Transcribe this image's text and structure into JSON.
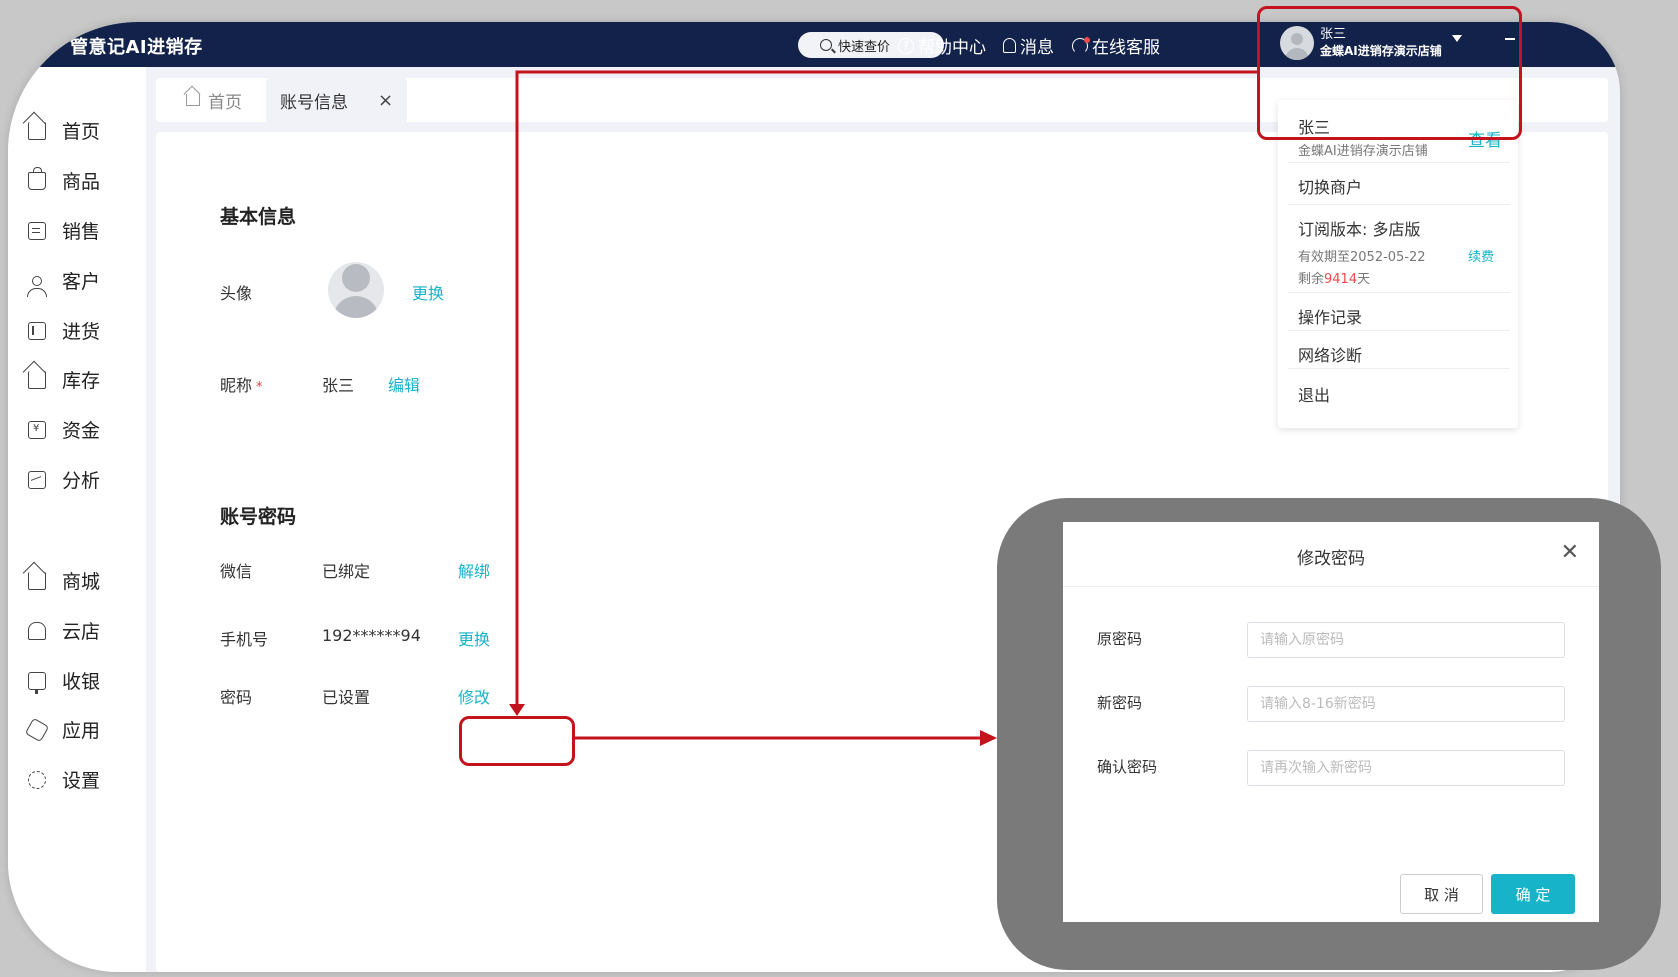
{
  "app": {
    "brand": "管意记AI进销存",
    "search_label": "快速查价",
    "topnav": {
      "help": "帮助中心",
      "messages": "消息",
      "service": "在线客服"
    },
    "user": {
      "name": "张三",
      "store": "金蝶AI进销存演示店铺"
    }
  },
  "sidebar": {
    "items": [
      {
        "label": "首页",
        "icon": "home-icon"
      },
      {
        "label": "商品",
        "icon": "bag-icon"
      },
      {
        "label": "销售",
        "icon": "document-icon"
      },
      {
        "label": "客户",
        "icon": "person-icon"
      },
      {
        "label": "进货",
        "icon": "book-icon"
      },
      {
        "label": "库存",
        "icon": "warehouse-icon"
      },
      {
        "label": "资金",
        "icon": "wallet-icon"
      },
      {
        "label": "分析",
        "icon": "chart-icon"
      },
      {
        "label": "商城",
        "icon": "mall-icon"
      },
      {
        "label": "云店",
        "icon": "shop-icon"
      },
      {
        "label": "收银",
        "icon": "cashier-icon"
      },
      {
        "label": "应用",
        "icon": "app-icon"
      },
      {
        "label": "设置",
        "icon": "gear-icon"
      }
    ]
  },
  "tabs": {
    "home": "首页",
    "account": "账号信息"
  },
  "basic": {
    "title": "基本信息",
    "avatar_label": "头像",
    "avatar_action": "更换",
    "nickname_label": "昵称",
    "nickname_required": "*",
    "nickname_value": "张三",
    "nickname_action": "编辑"
  },
  "account": {
    "title": "账号密码",
    "wechat_label": "微信",
    "wechat_value": "已绑定",
    "wechat_action": "解绑",
    "phone_label": "手机号",
    "phone_value": "192******94",
    "phone_action": "更换",
    "password_label": "密码",
    "password_value": "已设置",
    "password_action": "修改"
  },
  "dropdown": {
    "name": "张三",
    "store": "金蝶AI进销存演示店铺",
    "view": "查看",
    "switch": "切换商户",
    "plan": "订阅版本: 多店版",
    "expiry": "有效期至2052-05-22",
    "renew": "续费",
    "remaining_prefix": "剩余",
    "remaining_days": "9414",
    "remaining_suffix": "天",
    "log": "操作记录",
    "network": "网络诊断",
    "logout": "退出"
  },
  "dialog": {
    "title": "修改密码",
    "old_label": "原密码",
    "old_placeholder": "请输入原密码",
    "new_label": "新密码",
    "new_placeholder": "请输入8-16新密码",
    "confirm_label": "确认密码",
    "confirm_placeholder": "请再次输入新密码",
    "cancel": "取 消",
    "ok": "确 定"
  },
  "colors": {
    "header": "#12224a",
    "accent": "#19b3c9",
    "annotation": "#c3131c"
  }
}
